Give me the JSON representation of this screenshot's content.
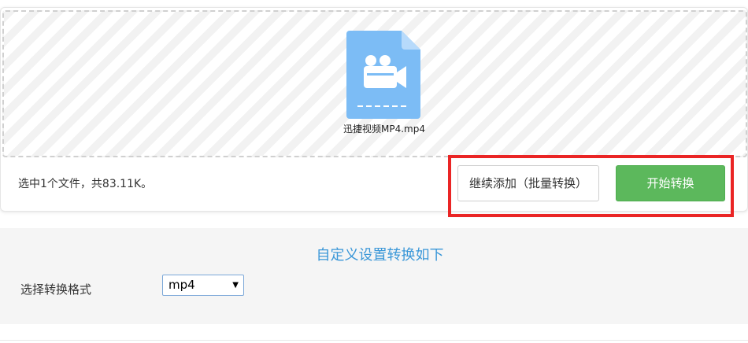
{
  "file": {
    "name": "迅捷视频MP4.mp4",
    "icon": "video-file-icon",
    "icon_color": "#7cbcf5"
  },
  "summary": {
    "text": "选中1个文件，共83.11K。"
  },
  "actions": {
    "add_more_label": "继续添加（批量转换）",
    "start_label": "开始转换",
    "start_color": "#5cb85c",
    "highlight_color": "#ea2525"
  },
  "settings": {
    "title": "自定义设置转换如下",
    "format_label": "选择转换格式",
    "format_value": "mp4"
  }
}
